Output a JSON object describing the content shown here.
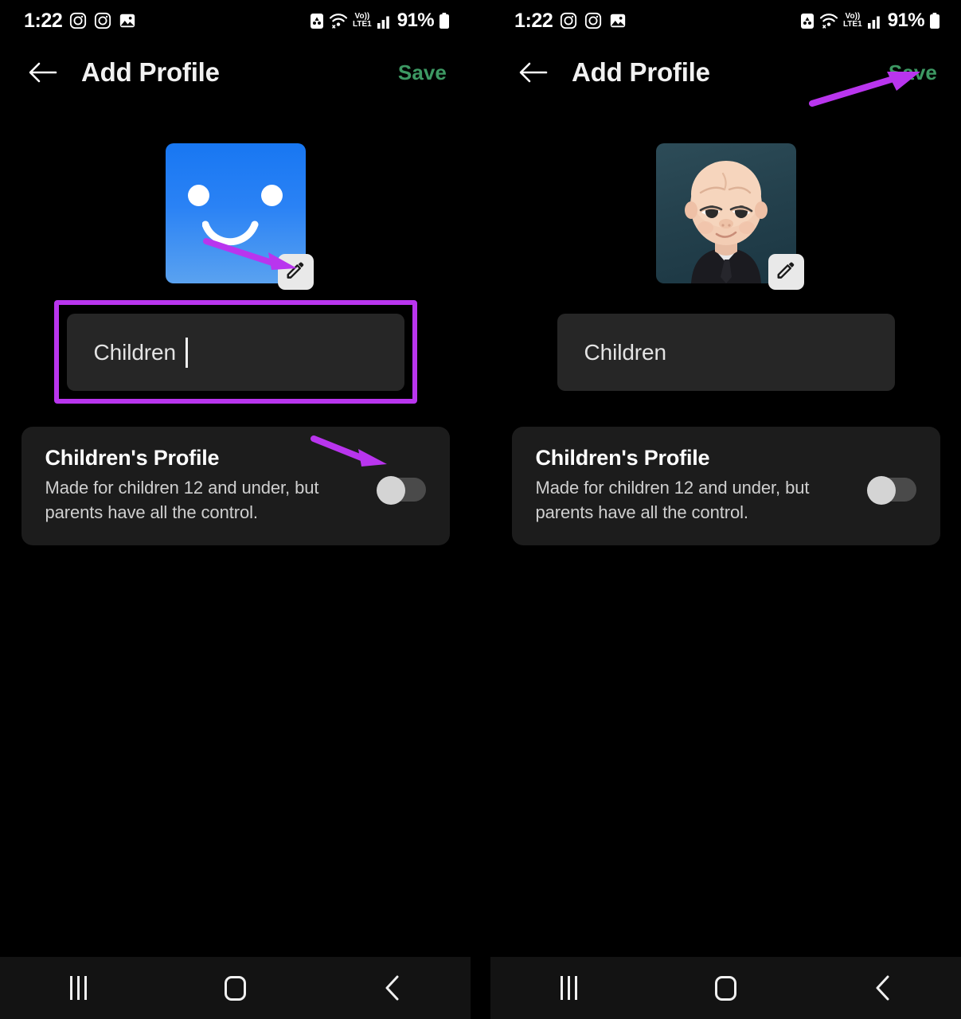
{
  "meta": {
    "app": "Add Profile screen",
    "panels": 2
  },
  "status_bar": {
    "time": "1:22",
    "battery_percent": "91%",
    "volte_top": "Vo))",
    "volte_bottom": "LTE1",
    "left_icons": [
      "instagram-icon",
      "instagram-icon",
      "photo-icon"
    ],
    "right_icons": [
      "app-notification-icon",
      "wifi-icon",
      "volte-icon",
      "signal-bars-icon",
      "battery-icon"
    ]
  },
  "app_bar": {
    "back_icon": "back-arrow-icon",
    "title": "Add Profile",
    "save_label": "Save",
    "save_color": "#3d9963"
  },
  "left_panel": {
    "avatar": {
      "type": "default-smiley-avatar",
      "colors": {
        "top": "#1877f2",
        "bottom": "#5aa2f0"
      },
      "edit_badge_icon": "pencil-icon"
    },
    "name_input": {
      "value": "Children",
      "has_caret": true,
      "highlighted": true,
      "highlight_color": "#b935ee"
    },
    "kids_card": {
      "title": "Children's Profile",
      "description": "Made for children 12 and under, but parents have all the control.",
      "toggle_state": "off"
    },
    "annotations": [
      {
        "name": "arrow-to-edit-avatar",
        "color": "#b935ee"
      },
      {
        "name": "arrow-to-kids-toggle",
        "color": "#b935ee"
      }
    ]
  },
  "right_panel": {
    "avatar": {
      "type": "boss-baby-photo-avatar",
      "colors": {
        "top": "#2d4c58",
        "bottom": "#1b3642"
      },
      "edit_badge_icon": "pencil-icon"
    },
    "name_input": {
      "value": "Children",
      "has_caret": false,
      "highlighted": false
    },
    "kids_card": {
      "title": "Children's Profile",
      "description": "Made for children 12 and under, but parents have all the control.",
      "toggle_state": "off"
    },
    "annotations": [
      {
        "name": "arrow-to-save-button",
        "color": "#b935ee"
      }
    ]
  },
  "nav_bar": {
    "recents_label": "recents-icon",
    "home_label": "home-icon",
    "back_label": "back-icon"
  }
}
